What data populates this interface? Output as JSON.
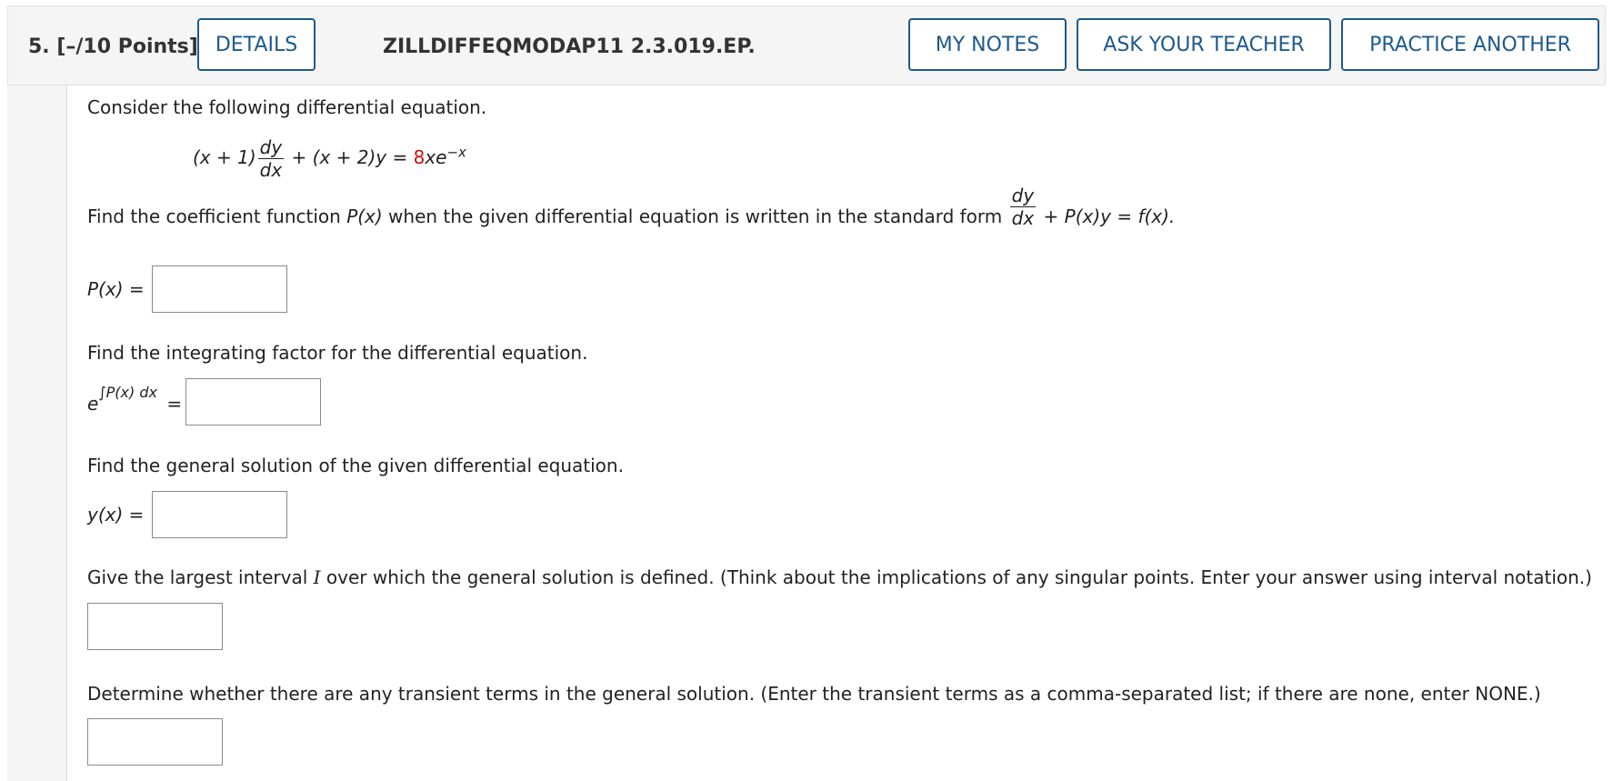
{
  "header": {
    "question_number": "5.",
    "points": "[–/10 Points]",
    "details_label": "DETAILS",
    "problem_code": "ZILLDIFFEQMODAP11 2.3.019.EP.",
    "my_notes_label": "MY NOTES",
    "ask_teacher_label": "ASK YOUR TEACHER",
    "practice_another_label": "PRACTICE ANOTHER"
  },
  "colors": {
    "accent": "#1d5a8c",
    "highlight": "#cc1111"
  },
  "question": {
    "intro": "Consider the following differential equation.",
    "equation": {
      "lhs_factor": "(x + 1)",
      "dy": "dy",
      "dx": "dx",
      "middle": " + (x + 2)y = ",
      "coefficient": "8",
      "rhs": "xe",
      "exponent": "−x"
    },
    "part1": {
      "prompt_before": "Find the coefficient function ",
      "prompt_px": "P(x)",
      "prompt_after": " when the given differential equation is written in the standard form ",
      "std_dy": "dy",
      "std_dx": "dx",
      "std_rest": " + P(x)y = f(x).",
      "label": "P(x) ="
    },
    "part2": {
      "prompt": "Find the integrating factor for the differential equation.",
      "label_base": "e",
      "label_exp": "∫P(x) dx",
      "label_eq": "="
    },
    "part3": {
      "prompt": "Find the general solution of the given differential equation.",
      "label": "y(x) ="
    },
    "part4": {
      "prompt_before": "Give the largest interval ",
      "prompt_var": "I",
      "prompt_after": " over which the general solution is defined. (Think about the implications of any singular points. Enter your answer using interval notation.)"
    },
    "part5": {
      "prompt": "Determine whether there are any transient terms in the general solution. (Enter the transient terms as a comma-separated list; if there are none, enter NONE.)"
    }
  }
}
